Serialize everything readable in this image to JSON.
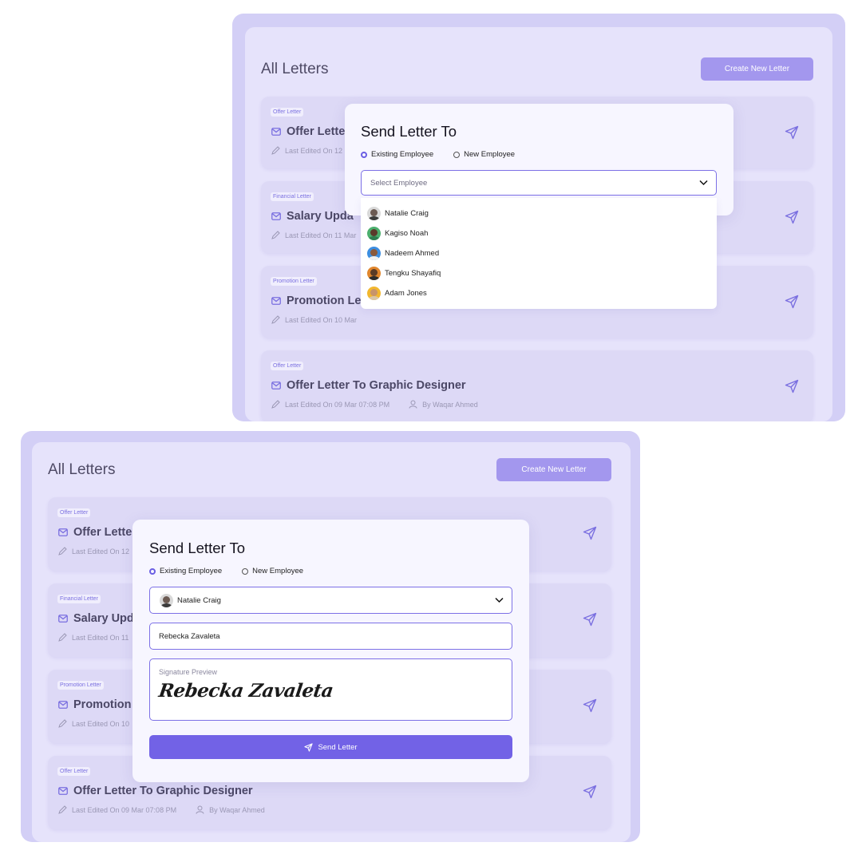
{
  "colors": {
    "accent": "#7262e6",
    "panel": "#d3cff6",
    "card": "#ddd9f6"
  },
  "screen1": {
    "list": {
      "title": "All Letters",
      "create_label": "Create New Letter",
      "cards": [
        {
          "badge": "Offer Letter",
          "title": "Offer Letter",
          "meta": "Last Edited On 12"
        },
        {
          "badge": "Financial Letter",
          "title": "Salary Upda",
          "meta": "Last Edited On 11 Mar"
        },
        {
          "badge": "Promotion Letter",
          "title": "Promotion Let",
          "meta": "Last Edited On 10 Mar"
        },
        {
          "badge": "Offer Letter",
          "title": "Offer Letter To Graphic Designer",
          "meta": "Last Edited On 09 Mar 07:08 PM",
          "author": "By Waqar Ahmed"
        }
      ]
    },
    "modal": {
      "title": "Send Letter To",
      "radio_existing": "Existing Employee",
      "radio_new": "New Employee",
      "select_placeholder": "Select Employee",
      "employees": [
        "Natalie Craig",
        "Kagiso Noah",
        "Nadeem Ahmed",
        "Tengku Shayafiq",
        "Adam Jones"
      ]
    }
  },
  "screen2": {
    "list": {
      "title": "All Letters",
      "create_label": "Create New Letter",
      "cards": [
        {
          "badge": "Offer Letter",
          "title": "Offer Letter",
          "meta": "Last Edited On 12"
        },
        {
          "badge": "Financial Letter",
          "title": "Salary Upda",
          "meta": "Last Edited On 11"
        },
        {
          "badge": "Promotion Letter",
          "title": "Promotion",
          "meta": "Last Edited On 10"
        },
        {
          "badge": "Offer Letter",
          "title": "Offer Letter To Graphic Designer",
          "meta": "Last Edited On 09 Mar 07:08 PM",
          "author": "By Waqar Ahmed"
        }
      ]
    },
    "modal": {
      "title": "Send Letter To",
      "radio_existing": "Existing Employee",
      "radio_new": "New Employee",
      "selected_employee": "Natalie Craig",
      "name_value": "Rebecka Zavaleta",
      "signature_label": "Signature Preview",
      "signature_text": "Rebecka Zavaleta",
      "send_label": "Send Letter"
    }
  }
}
